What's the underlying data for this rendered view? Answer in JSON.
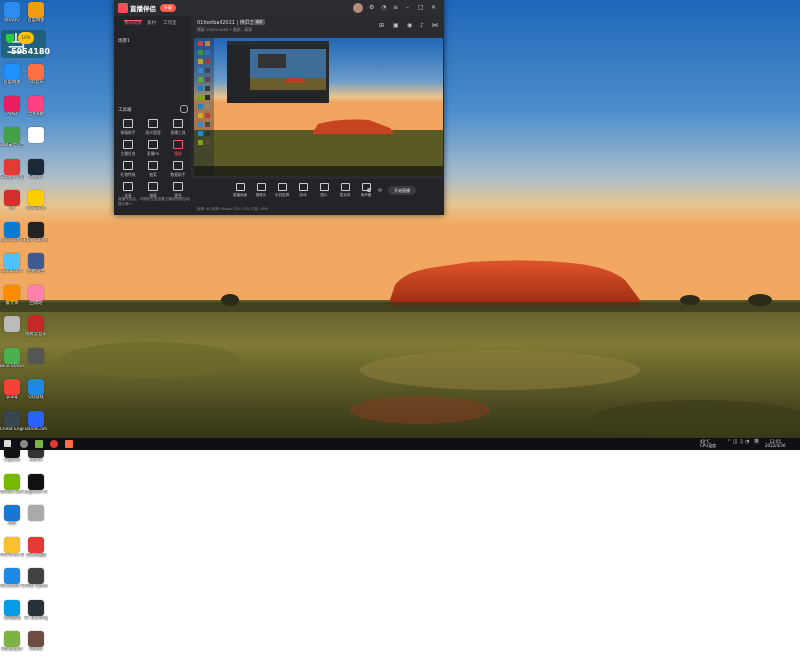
{
  "desktop": {
    "widget_number": "5954180",
    "widget_big_glyph": "当",
    "widget_pct": "10%",
    "icons": [
      {
        "label": "腾讯QQ",
        "color": "#2d8cf0"
      },
      {
        "label": "百度网盘",
        "color": "#f39c12"
      },
      {
        "label": "百度网盘",
        "color": "#1e90ff"
      },
      {
        "label": "QQ音乐",
        "color": "#ff7043"
      },
      {
        "label": "AMD",
        "color": "#e91e63"
      },
      {
        "label": "全民K歌",
        "color": "#ff4081"
      },
      {
        "label": "360安全卫士",
        "color": "#43a047"
      },
      {
        "label": "",
        "color": "#ffffff"
      },
      {
        "label": "Google Chrome",
        "color": "#e53935"
      },
      {
        "label": "Steam",
        "color": "#1b2838"
      },
      {
        "label": "EA",
        "color": "#d32f2f"
      },
      {
        "label": "WeGame",
        "color": "#ffcc00"
      },
      {
        "label": "Microsoft Edge",
        "color": "#0a7bd1"
      },
      {
        "label": "Epic Games",
        "color": "#222222"
      },
      {
        "label": "Bandicam",
        "color": "#4fc3f7"
      },
      {
        "label": "绝地求生",
        "color": "#3e5a8e"
      },
      {
        "label": "鲁大师",
        "color": "#fb8c00"
      },
      {
        "label": "回收站",
        "color": "#ff80ab"
      },
      {
        "label": "",
        "color": "#bbbbbb"
      },
      {
        "label": "网易云音乐",
        "color": "#c62828"
      },
      {
        "label": "Blue Stacks",
        "color": "#4caf50"
      },
      {
        "label": "",
        "color": "#555555"
      },
      {
        "label": "pubg",
        "color": "#f44336"
      },
      {
        "label": "QQ游戏",
        "color": "#1e88e5"
      },
      {
        "label": "Cheat Engine",
        "color": "#37474f"
      },
      {
        "label": "BandiCam",
        "color": "#2962ff"
      },
      {
        "label": "CapCut",
        "color": "#111111"
      },
      {
        "label": "sekiro",
        "color": "#333333"
      },
      {
        "label": "Nvidia GeForce",
        "color": "#76b900"
      },
      {
        "label": "Logitech G HUB",
        "color": "#111111"
      },
      {
        "label": "迅雷",
        "color": "#1976d2"
      },
      {
        "label": "",
        "color": "#aaaaaa"
      },
      {
        "label": "ProFocus 64-bit",
        "color": "#fbc02d"
      },
      {
        "label": "QQ浏览器",
        "color": "#e53935"
      },
      {
        "label": "Microsoft Teams",
        "color": "#1e88e5"
      },
      {
        "label": "AMD Ryzen Master",
        "color": "#424242"
      },
      {
        "label": "360游戏",
        "color": "#039be5"
      },
      {
        "label": "PC Building Simulator",
        "color": "#263238"
      },
      {
        "label": "Wallpaper",
        "color": "#7cb342"
      },
      {
        "label": "Reflex",
        "color": "#6d4c41"
      }
    ]
  },
  "app": {
    "name": "直播伴侣",
    "upgrade_label": "升级",
    "tabs": [
      "我的场景",
      "素材",
      "工作室"
    ],
    "scene_label": "场景1",
    "tools_title": "工具箱",
    "tools": [
      {
        "label": "弹幕助手",
        "red": false
      },
      {
        "label": "观众管理",
        "red": false
      },
      {
        "label": "直播工具",
        "red": false
      },
      {
        "label": "主播任务",
        "red": false
      },
      {
        "label": "直播PK",
        "red": false
      },
      {
        "label": "福袋",
        "red": true
      },
      {
        "label": "礼物特效",
        "red": false
      },
      {
        "label": "抽奖",
        "red": false
      },
      {
        "label": "数据助手",
        "red": false
      },
      {
        "label": "连麦",
        "red": false
      },
      {
        "label": "弹幕",
        "red": false
      },
      {
        "label": "更多",
        "red": false
      }
    ],
    "notice": "直播开启后，可随时在此查看主播动态和互动提示哦～",
    "room_title": "01football2021 | 横屏直播",
    "room_badge": "横屏",
    "room_sub": "横屏 1920×1080 • 画质：高清",
    "bottom_tools": [
      {
        "label": "直播画面"
      },
      {
        "label": "摄像头"
      },
      {
        "label": "手机投屏"
      },
      {
        "label": "游戏"
      },
      {
        "label": "图片"
      },
      {
        "label": "麦克风"
      },
      {
        "label": "扬声器"
      }
    ],
    "go_live": "开始直播",
    "status": "帧率: 60 码率: 0kbps CPU: 12% 内存: 46%"
  },
  "taskbar": {
    "temp": "49°C",
    "temp_label": "CPU温度",
    "time": "13:05",
    "date": "2022/4/30",
    "lang": "英"
  }
}
